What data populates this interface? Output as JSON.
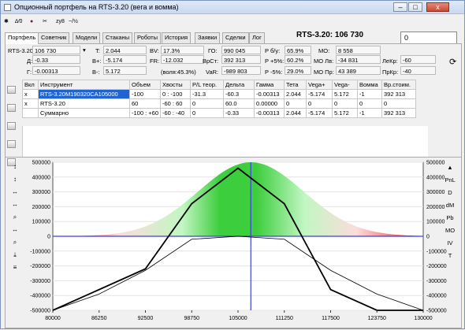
{
  "window": {
    "title": "Опционный портфель на RTS-3.20 (вега и вомма)",
    "minimize": "–",
    "maximize": "□",
    "close": "x",
    "headline": "RTS-3.20: 106 730",
    "headline_input": "0"
  },
  "toolbar": {
    "icons": [
      "gear-icon",
      "delta-icon",
      "cherry-icon",
      "scissors-icon",
      "undo-icon",
      "scenario-icon",
      "filter-icon"
    ],
    "labels": [
      "✱",
      "∆⁄0",
      "●",
      "✂",
      "zy8",
      "~/½"
    ]
  },
  "tabs": [
    "Портфель",
    "Советник",
    "Модели",
    "Стаканы",
    "Роботы",
    "История",
    "Заявки",
    "Сделки",
    "Лог"
  ],
  "fields": {
    "instrument_label": "RTS-3.20",
    "price": "106 730",
    "d_label": "Д:",
    "d_value": "-0.33",
    "g_label": "Г:",
    "g_value": "-0.00313",
    "t_label": "T:",
    "t_value": "2.044",
    "bplus_label": "B+:",
    "bplus_value": "-5.174",
    "bminus_label": "B-:",
    "bminus_value": "5.172",
    "bv_label": "BV:",
    "bv_value": "17.3%",
    "fr_label": "FR:",
    "fr_value": "-12.032",
    "vol_note": "(воля:45.3%)",
    "go_label": "ГО:",
    "go_value": "990 045",
    "vrst_label": "ВрСт:",
    "vrst_value": "392 313",
    "var_label": "VaR:",
    "var_value": "-989 803",
    "pby_label": "P б/у:",
    "pby_value": "65.9%",
    "pplus_label": "P +5%:",
    "pplus_value": "60.2%",
    "pminus_label": "P -5%:",
    "pminus_value": "29.0%",
    "mo_label": "МО:",
    "mo_value": "8 558",
    "molv_label": "МО Лв:",
    "molv_value": "-34 831",
    "mopr_label": "МО Пр:",
    "mopr_value": "43 389",
    "lekr_label": "ЛеКр:",
    "lekr_value": "-60",
    "prkr_label": "ПрКр:",
    "prkr_value": "-40"
  },
  "table": {
    "headers": [
      "Вкл",
      "Инструмент",
      "Объем",
      "Хвосты",
      "P/L теор.",
      "Дельта",
      "Гамма",
      "Тета",
      "Vega+",
      "Vega-",
      "Вомма",
      "Вр.стоим."
    ],
    "rows": [
      [
        "x",
        "RTS-3.20M190320CA105000",
        "-100",
        "0 : -100",
        "-31.3",
        "-60.3",
        "-0.00313",
        "2.044",
        "-5.174",
        "5.172",
        "-1",
        "392 313"
      ],
      [
        "x",
        "RTS-3.20",
        "60",
        "-60 : 60",
        "0",
        "60.0",
        "0.00000",
        "0",
        "0",
        "0",
        "0",
        "0"
      ],
      [
        "",
        "Суммарно",
        "-100 : +60",
        "-60 : -40",
        "0",
        "-0.33",
        "-0.00313",
        "2.044",
        "-5.174",
        "5.172",
        "-1",
        "392 313"
      ]
    ]
  },
  "left_tools": [
    "↕",
    "↕",
    "↔",
    "↔",
    "⌕",
    "↔",
    "⌕",
    "⤓",
    "≡"
  ],
  "right_tools": [
    "▲",
    "PnL",
    "D",
    "dM",
    "Pb",
    "МО",
    "IV",
    "T"
  ],
  "chart_data": {
    "type": "line",
    "x": [
      80000,
      86250,
      92500,
      98750,
      105000,
      111250,
      117500,
      123750,
      130000
    ],
    "xlabel": "",
    "ylabel": "",
    "ylim": [
      -500000,
      500000
    ],
    "yticks": [
      500000,
      400000,
      300000,
      200000,
      100000,
      0,
      -100000,
      -200000,
      -300000,
      -400000,
      -500000
    ],
    "series": [
      {
        "values": [
          -500000,
          -360000,
          -220000,
          220000,
          460000,
          220000,
          -360000,
          -500000,
          -500000
        ]
      },
      {
        "values": [
          -500000,
          -390000,
          -230000,
          -20000,
          0,
          -20000,
          -230000,
          -390000,
          -500000
        ]
      }
    ],
    "marker_x": 106730,
    "colors": {
      "profit": "#33cc33",
      "loss": "#e51e1e",
      "line": "#000000",
      "zero": "#3f3fe0"
    }
  }
}
